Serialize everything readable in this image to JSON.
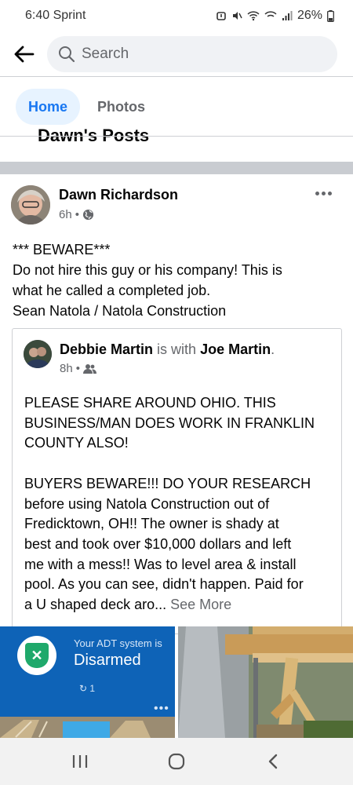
{
  "status_bar": {
    "time_carrier": "6:40 Sprint",
    "battery": "26%"
  },
  "search": {
    "placeholder": "Search"
  },
  "tabs": [
    {
      "label": "Home",
      "active": true
    },
    {
      "label": "Photos",
      "active": false
    }
  ],
  "section": {
    "heading_cut": "Dawn's Posts"
  },
  "post": {
    "author": "Dawn Richardson",
    "time": "6h",
    "lines": [
      "*** BEWARE***",
      "Do not hire this guy or his company! This is",
      "what he called a completed job.",
      "Sean Natola / Natola Construction"
    ]
  },
  "shared_post": {
    "author": "Debbie Martin",
    "with_text": "is with",
    "with_name": "Joe Martin",
    "period": ".",
    "time": "8h",
    "lines": [
      "PLEASE SHARE AROUND OHIO. THIS",
      "BUSINESS/MAN DOES WORK IN FRANKLIN",
      "COUNTY ALSO!",
      "",
      "BUYERS BEWARE!!! DO YOUR RESEARCH",
      "before using Natola Construction out of",
      "Fredicktown,  OH!! The owner is shady at",
      "best and took over $10,000 dollars and left",
      "me with a mess!!  Was to level area & install",
      "pool. As you can see, didn't happen. Paid for"
    ],
    "last_line": "a U shaped deck aro... ",
    "see_more": "See More"
  },
  "photo_adt": {
    "label": "Your ADT system is",
    "status": "Disarmed",
    "count": "1",
    "dots": "•••"
  },
  "colors": {
    "accent": "#1877f2",
    "muted": "#65676b",
    "adt_blue": "#0e63b7",
    "adt_green": "#1fa96b"
  },
  "icons": {
    "back": "arrow-left-icon",
    "search": "search-icon",
    "globe": "globe-icon",
    "friends": "friends-icon",
    "more": "more-horizontal-icon",
    "nav_recents": "recents-icon",
    "nav_home": "home-circle-icon",
    "nav_back": "chevron-left-icon"
  }
}
